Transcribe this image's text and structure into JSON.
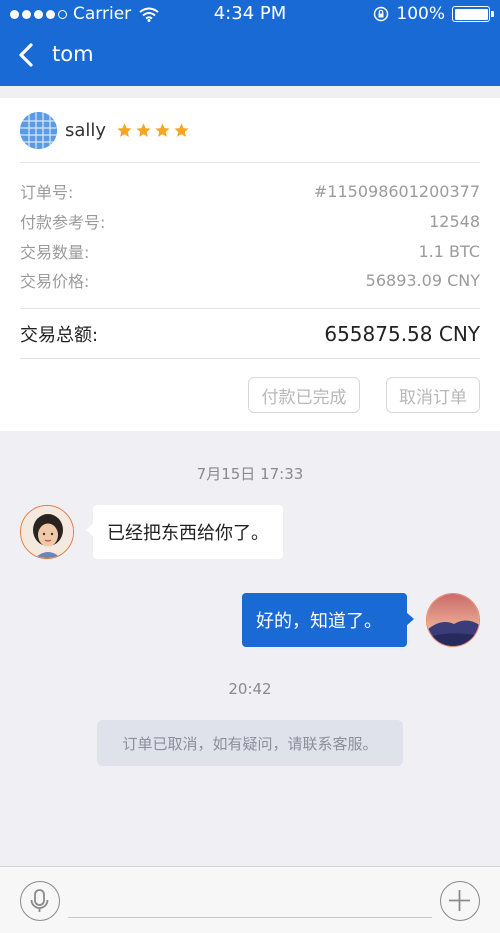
{
  "status_bar": {
    "carrier": "Carrier",
    "time": "4:34 PM",
    "battery": "100%"
  },
  "nav": {
    "title": "tom"
  },
  "order": {
    "seller_name": "sally",
    "rating": 4,
    "rows": [
      {
        "label": "订单号:",
        "value": "#115098601200377"
      },
      {
        "label": "付款参考号:",
        "value": "12548"
      },
      {
        "label": "交易数量:",
        "value": "1.1 BTC"
      },
      {
        "label": "交易价格:",
        "value": "56893.09 CNY"
      }
    ],
    "total_label": "交易总额:",
    "total_value": "655875.58 CNY",
    "buttons": {
      "paid": "付款已完成",
      "cancel": "取消订单"
    }
  },
  "chat": {
    "time1": "7月15日 17:33",
    "msg_in": "已经把东西给你了。",
    "msg_out": "好的，知道了。",
    "time2": "20:42",
    "system": "订单已取消，如有疑问，请联系客服。"
  },
  "colors": {
    "accent": "#1a6ad6",
    "star": "#f5a623",
    "background": "#efeff4"
  },
  "icons": {
    "back": "chevron-left-icon",
    "voice": "microphone-icon",
    "add": "plus-icon",
    "wifi": "wifi-icon",
    "lock": "rotation-lock-icon"
  }
}
